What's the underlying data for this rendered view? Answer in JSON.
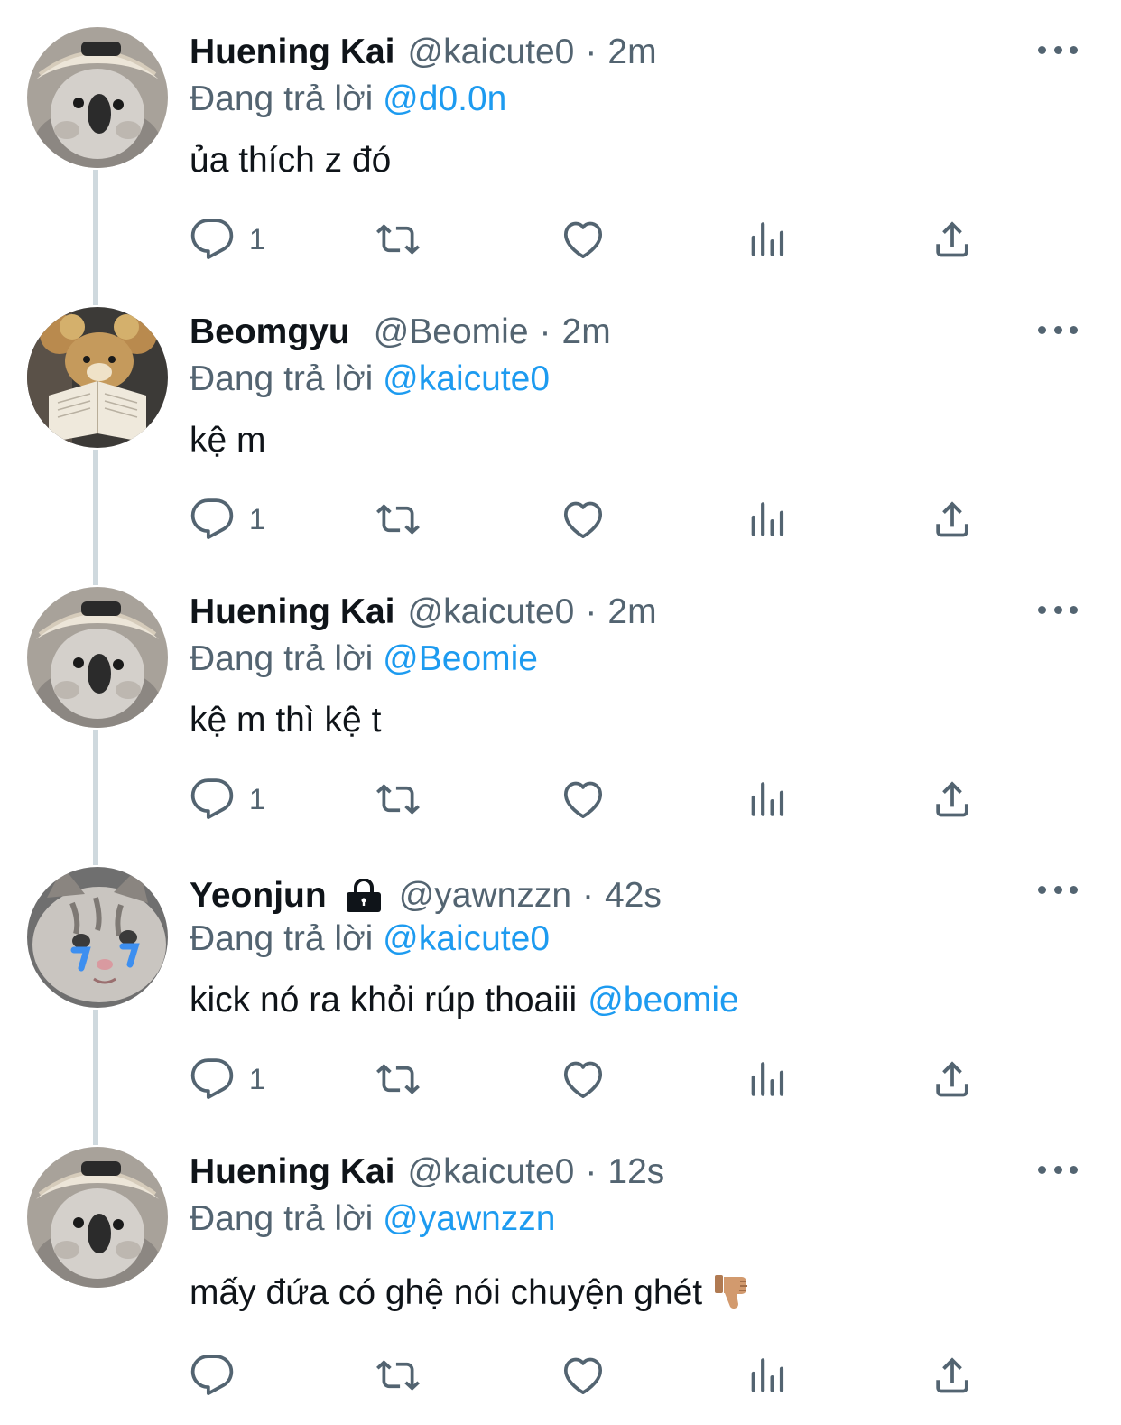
{
  "colors": {
    "text": "#0f1419",
    "secondary": "#536471",
    "mention": "#1d9bf0",
    "thread_line": "#cfd9de"
  },
  "tweets": [
    {
      "name": "Huening Kai",
      "handle": "@kaicute0",
      "separator": "·",
      "time": "2m",
      "replying_prefix": "Đang trả lời",
      "replying_to": "@d0.0n",
      "text": "ủa thích z đó",
      "reply_count": "1",
      "avatar_icon": "penguin-avatar"
    },
    {
      "name": "Beomgyu",
      "handle": "@Beomie",
      "separator": "·",
      "time": "2m",
      "replying_prefix": "Đang trả lời",
      "replying_to": "@kaicute0",
      "text": "kệ m",
      "reply_count": "1",
      "avatar_icon": "bear-with-book-avatar"
    },
    {
      "name": "Huening Kai",
      "handle": "@kaicute0",
      "separator": "·",
      "time": "2m",
      "replying_prefix": "Đang trả lời",
      "replying_to": "@Beomie",
      "text": "kệ m thì kệ t",
      "reply_count": "1",
      "avatar_icon": "penguin-avatar"
    },
    {
      "name": "Yeonjun",
      "handle": "@yawnzzn",
      "separator": "·",
      "time": "42s",
      "replying_prefix": "Đang trả lời",
      "replying_to": "@kaicute0",
      "text": "kick nó ra khỏi rúp thoaiii",
      "text_mention": "@beomie",
      "reply_count": "1",
      "protected_icon": "lock-icon",
      "avatar_icon": "crying-kitten-avatar"
    },
    {
      "name": "Huening Kai",
      "handle": "@kaicute0",
      "separator": "·",
      "time": "12s",
      "replying_prefix": "Đang trả lời",
      "replying_to": "@yawnzzn",
      "text": "mấy đứa có ghệ nói chuyện ghét",
      "text_emoji": "thumbs-down-emoji",
      "reply_count": "",
      "avatar_icon": "penguin-avatar"
    }
  ]
}
